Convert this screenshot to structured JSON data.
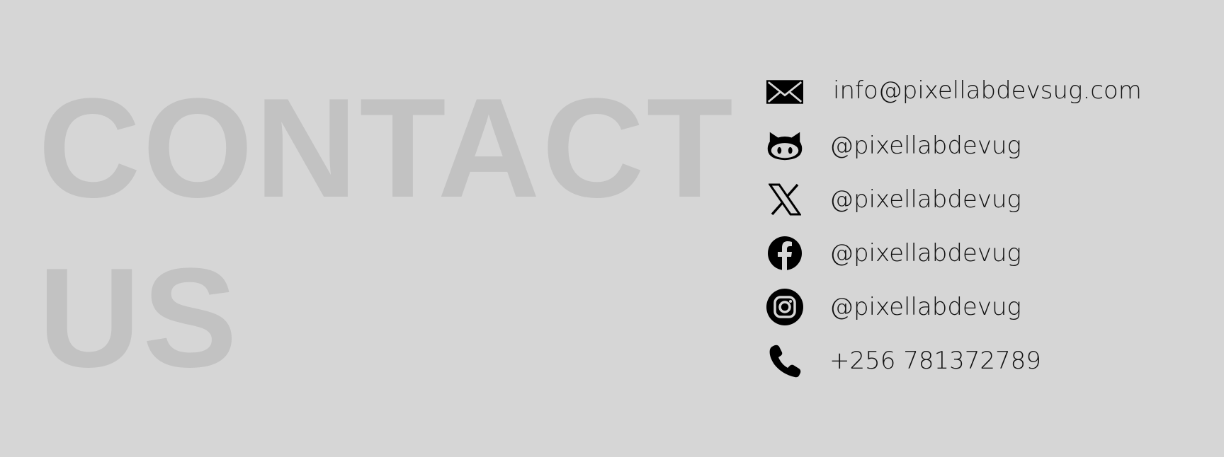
{
  "heading": {
    "line1": "CONTACT",
    "line2": "US"
  },
  "contacts": [
    {
      "icon": "envelope-icon",
      "text": "info@pixellabdevsug.com"
    },
    {
      "icon": "github-icon",
      "text": "@pixellabdevug"
    },
    {
      "icon": "x-twitter-icon",
      "text": "@pixellabdevug"
    },
    {
      "icon": "facebook-icon",
      "text": "@pixellabdevug"
    },
    {
      "icon": "instagram-icon",
      "text": "@pixellabdevug"
    },
    {
      "icon": "phone-icon",
      "text": "+256 781372789"
    }
  ],
  "colors": {
    "background": "#d6d6d6",
    "heading": "#c2c2c2",
    "text": "#111111",
    "icon": "#000000"
  }
}
